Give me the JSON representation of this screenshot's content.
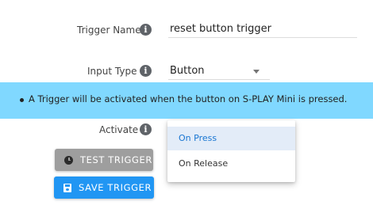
{
  "form": {
    "trigger_name": {
      "label": "Trigger Name",
      "value": "reset button trigger"
    },
    "input_type": {
      "label": "Input Type",
      "value": "Button"
    },
    "activate": {
      "label": "Activate",
      "options": [
        "On Press",
        "On Release"
      ],
      "selected_index": 0
    },
    "info_glyph": "i"
  },
  "banner": {
    "text": "A Trigger will be activated when the button on S-PLAY Mini is pressed.",
    "color": "#80d8ff"
  },
  "buttons": {
    "test": {
      "label": "TEST TRIGGER",
      "icon": "clock-icon",
      "color": "#9e9e9e"
    },
    "save": {
      "label": "SAVE TRIGGER",
      "icon": "save-icon",
      "color": "#2196f3"
    }
  }
}
